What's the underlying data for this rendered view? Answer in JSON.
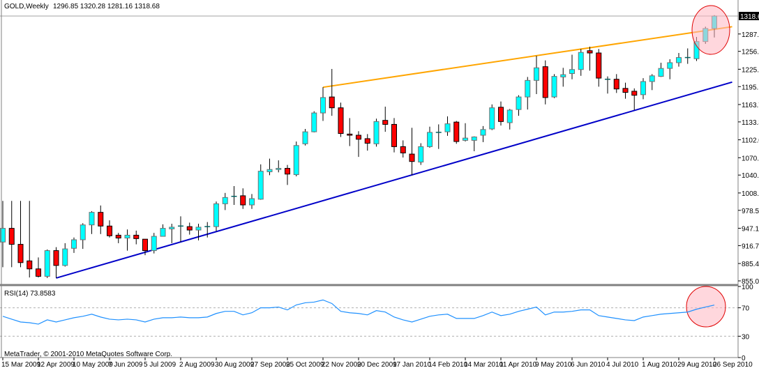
{
  "header": {
    "symbol_label": "GOLD,Weekly",
    "ohlc_label": "1296.85 1320.28 1281.16 1318.68"
  },
  "rsi_panel": {
    "label": "RSI(14) 73.8583"
  },
  "copyright": "MetaTrader, © 2001-2010 MetaQuotes Software Corp.",
  "colors": {
    "bull": "#00FFFF",
    "bear": "#FF0000",
    "wick": "#000000",
    "rsi_line": "#1E90FF",
    "support_trendline": "#0000C8",
    "resistance_trendline": "#FFA500",
    "highlight": "#FFB6C1",
    "highlight_border": "#E00000"
  },
  "chart_data": [
    {
      "type": "candlestick",
      "title": "GOLD,Weekly",
      "ylim": [
        855.0,
        1318.68
      ],
      "current_price": "1318.68",
      "y_tick_labels": [
        "1287.25",
        "1256.85",
        "1225.50",
        "1195.10",
        "1163.75",
        "1133.35",
        "1102.00",
        "1070.65",
        "1040.25",
        "1008.90",
        "978.50",
        "947.15",
        "916.75",
        "885.40",
        "855.00"
      ],
      "x_tick_labels": [
        "15 Mar 2009",
        "12 Apr 2009",
        "10 May 2009",
        "7 Jun 2009",
        "5 Jul 2009",
        "2 Aug 2009",
        "30 Aug 2009",
        "27 Sep 2009",
        "25 Oct 2009",
        "22 Nov 2009",
        "20 Dec 2009",
        "17 Jan 2010",
        "14 Feb 2010",
        "14 Mar 2010",
        "11 Apr 2010",
        "9 May 2010",
        "6 Jun 2010",
        "4 Jul 2010",
        "1 Aug 2010",
        "29 Aug 2010",
        "26 Sep 2010"
      ],
      "candle_fields": [
        "date",
        "open",
        "high",
        "low",
        "close"
      ],
      "candles": [
        [
          "2009-03-15",
          923,
          995,
          879,
          947
        ],
        [
          "2009-03-22",
          947,
          995,
          879,
          919
        ],
        [
          "2009-03-29",
          919,
          995,
          879,
          887
        ],
        [
          "2009-04-05",
          890,
          995,
          861,
          876
        ],
        [
          "2009-04-12",
          876,
          896,
          861,
          863
        ],
        [
          "2009-04-19",
          863,
          910,
          860,
          908
        ],
        [
          "2009-04-26",
          908,
          914,
          860,
          882
        ],
        [
          "2009-05-03",
          882,
          921,
          880,
          911
        ],
        [
          "2009-05-10",
          912,
          931,
          904,
          927
        ],
        [
          "2009-05-17",
          927,
          956,
          911,
          953
        ],
        [
          "2009-05-24",
          953,
          977,
          937,
          975
        ],
        [
          "2009-05-31",
          975,
          987,
          937,
          951
        ],
        [
          "2009-06-07",
          951,
          961,
          931,
          934
        ],
        [
          "2009-06-14",
          935,
          939,
          921,
          930
        ],
        [
          "2009-06-21",
          930,
          945,
          908,
          935
        ],
        [
          "2009-06-28",
          935,
          943,
          919,
          929
        ],
        [
          "2009-07-05",
          928,
          928,
          900,
          908
        ],
        [
          "2009-07-12",
          908,
          939,
          903,
          933
        ],
        [
          "2009-07-19",
          933,
          954,
          933,
          947
        ],
        [
          "2009-07-26",
          946,
          955,
          921,
          949
        ],
        [
          "2009-08-02",
          951,
          968,
          923,
          951
        ],
        [
          "2009-08-09",
          950,
          957,
          936,
          944
        ],
        [
          "2009-08-16",
          944,
          955,
          926,
          949
        ],
        [
          "2009-08-23",
          949,
          958,
          931,
          950
        ],
        [
          "2009-08-30",
          950,
          994,
          942,
          990
        ],
        [
          "2009-09-06",
          990,
          1009,
          979,
          1001
        ],
        [
          "2009-09-13",
          1002,
          1021,
          988,
          1003
        ],
        [
          "2009-09-20",
          1004,
          1017,
          981,
          988
        ],
        [
          "2009-09-27",
          988,
          1007,
          981,
          999
        ],
        [
          "2009-10-04",
          998,
          1059,
          997,
          1047
        ],
        [
          "2009-10-11",
          1046,
          1069,
          1040,
          1050
        ],
        [
          "2009-10-18",
          1050,
          1066,
          1045,
          1052
        ],
        [
          "2009-10-25",
          1052,
          1058,
          1023,
          1042
        ],
        [
          "2009-11-01",
          1041,
          1099,
          1038,
          1092
        ],
        [
          "2009-11-08",
          1095,
          1121,
          1092,
          1116
        ],
        [
          "2009-11-15",
          1116,
          1152,
          1115,
          1149
        ],
        [
          "2009-11-22",
          1149,
          1194,
          1135,
          1176
        ],
        [
          "2009-11-29",
          1177,
          1226,
          1144,
          1158
        ],
        [
          "2009-12-06",
          1158,
          1167,
          1107,
          1113
        ],
        [
          "2009-12-13",
          1112,
          1140,
          1091,
          1110
        ],
        [
          "2009-12-20",
          1110,
          1117,
          1072,
          1103
        ],
        [
          "2009-12-27",
          1104,
          1112,
          1083,
          1096
        ],
        [
          "2010-01-03",
          1095,
          1139,
          1090,
          1134
        ],
        [
          "2010-01-10",
          1136,
          1160,
          1116,
          1129
        ],
        [
          "2010-01-17",
          1129,
          1140,
          1080,
          1090
        ],
        [
          "2010-01-24",
          1090,
          1101,
          1071,
          1079
        ],
        [
          "2010-01-31",
          1077,
          1123,
          1040,
          1064
        ],
        [
          "2010-02-07",
          1063,
          1096,
          1058,
          1090
        ],
        [
          "2010-02-14",
          1090,
          1125,
          1088,
          1115
        ],
        [
          "2010-02-21",
          1115,
          1129,
          1086,
          1115
        ],
        [
          "2010-02-28",
          1116,
          1143,
          1109,
          1130
        ],
        [
          "2010-03-07",
          1133,
          1135,
          1095,
          1099
        ],
        [
          "2010-03-14",
          1101,
          1131,
          1099,
          1105
        ],
        [
          "2010-03-21",
          1101,
          1108,
          1082,
          1107
        ],
        [
          "2010-03-28",
          1110,
          1126,
          1098,
          1120
        ],
        [
          "2010-04-04",
          1121,
          1164,
          1119,
          1158
        ],
        [
          "2010-04-11",
          1159,
          1169,
          1127,
          1134
        ],
        [
          "2010-04-18",
          1132,
          1156,
          1120,
          1154
        ],
        [
          "2010-04-25",
          1155,
          1180,
          1144,
          1177
        ],
        [
          "2010-05-02",
          1177,
          1212,
          1155,
          1206
        ],
        [
          "2010-05-09",
          1206,
          1249,
          1182,
          1228
        ],
        [
          "2010-05-16",
          1230,
          1241,
          1164,
          1176
        ],
        [
          "2010-05-23",
          1177,
          1217,
          1175,
          1213
        ],
        [
          "2010-05-30",
          1212,
          1228,
          1195,
          1216
        ],
        [
          "2010-06-06",
          1218,
          1251,
          1208,
          1225
        ],
        [
          "2010-06-13",
          1225,
          1261,
          1214,
          1255
        ],
        [
          "2010-06-20",
          1258,
          1265,
          1223,
          1254
        ],
        [
          "2010-06-27",
          1254,
          1261,
          1195,
          1210
        ],
        [
          "2010-07-04",
          1208,
          1213,
          1183,
          1208
        ],
        [
          "2010-07-11",
          1208,
          1217,
          1184,
          1191
        ],
        [
          "2010-07-18",
          1192,
          1202,
          1174,
          1185
        ],
        [
          "2010-07-25",
          1187,
          1192,
          1154,
          1180
        ],
        [
          "2010-08-01",
          1181,
          1210,
          1173,
          1204
        ],
        [
          "2010-08-08",
          1204,
          1217,
          1189,
          1214
        ],
        [
          "2010-08-15",
          1213,
          1237,
          1212,
          1227
        ],
        [
          "2010-08-22",
          1227,
          1243,
          1208,
          1237
        ],
        [
          "2010-08-29",
          1237,
          1254,
          1230,
          1246
        ],
        [
          "2010-09-05",
          1246,
          1262,
          1235,
          1246
        ],
        [
          "2010-09-12",
          1244,
          1282,
          1240,
          1274
        ],
        [
          "2010-09-19",
          1274,
          1300,
          1270,
          1296.85
        ],
        [
          "2010-09-26",
          1296.85,
          1320.28,
          1281.16,
          1318.68
        ]
      ],
      "trendlines": [
        {
          "role": "support",
          "from": [
            "2009-04-26",
            860
          ],
          "to": [
            "2010-10-10",
            1203
          ]
        },
        {
          "role": "resistance",
          "from": [
            "2009-11-22",
            1194
          ],
          "to": [
            "2010-10-10",
            1300
          ]
        }
      ],
      "highlight": "last candles circled"
    },
    {
      "type": "line",
      "title": "RSI(14) 73.8583",
      "ylim": [
        0,
        100
      ],
      "levels": [
        70,
        30
      ],
      "y_tick_labels": [
        "100",
        "70",
        "30",
        "0"
      ],
      "values": [
        58,
        54,
        50,
        49,
        47,
        53,
        50,
        53,
        56,
        58,
        61,
        57,
        54,
        53,
        54,
        53,
        50,
        54,
        56,
        56,
        57,
        56,
        56,
        57,
        62,
        65,
        65,
        60,
        63,
        70,
        70,
        71,
        67,
        74,
        77,
        78,
        81,
        76,
        65,
        63,
        62,
        60,
        66,
        64,
        57,
        53,
        50,
        54,
        58,
        60,
        61,
        55,
        55,
        55,
        59,
        64,
        59,
        61,
        65,
        68,
        71,
        60,
        64,
        64,
        65,
        67,
        67,
        59,
        57,
        55,
        53,
        52,
        57,
        59,
        61,
        62,
        63,
        64,
        68,
        71,
        73.8583
      ],
      "highlight": "last values circled"
    }
  ]
}
